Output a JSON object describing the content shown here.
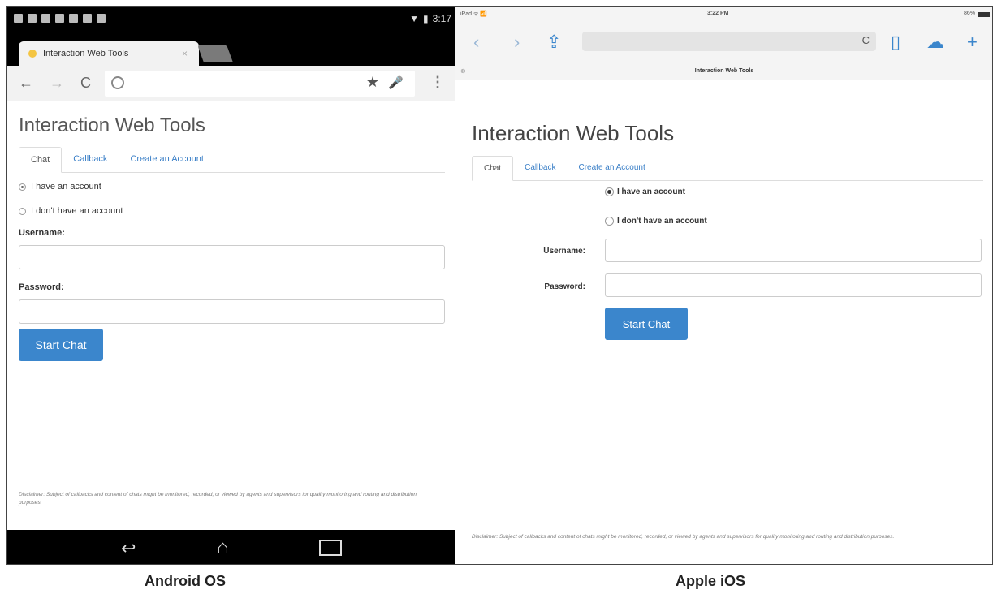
{
  "android": {
    "status_time": "3:17",
    "tab_title": "Interaction Web Tools",
    "tab_close": "×",
    "page_title": "Interaction Web Tools",
    "tabs": [
      "Chat",
      "Callback",
      "Create an Account"
    ],
    "radio_have": "I have an account",
    "radio_dont": "I don't have an account",
    "username_label": "Username:",
    "password_label": "Password:",
    "start_chat": "Start Chat",
    "disclaimer": "Disclaimer: Subject of callbacks and content of chats might be monitored, recorded, or viewed by agents and supervisors for quality monitoring and routing and distribution purposes.",
    "caption": "Android OS"
  },
  "ios": {
    "status_left": "iPad ᯤ 📶",
    "status_time": "3:22 PM",
    "status_battery": "86%",
    "tab_title": "Interaction Web Tools",
    "page_title": "Interaction Web Tools",
    "tabs": [
      "Chat",
      "Callback",
      "Create an Account"
    ],
    "radio_have": "I have an account",
    "radio_dont": "I don't have an account",
    "username_label": "Username:",
    "password_label": "Password:",
    "start_chat": "Start Chat",
    "disclaimer": "Disclaimer: Subject of callbacks and content of chats might be monitored, recorded, or viewed by agents and supervisors for quality monitoring and routing and distribution purposes.",
    "caption": "Apple iOS"
  },
  "icons": {
    "back": "back-arrow-icon",
    "forward": "forward-arrow-icon",
    "reload": "reload-icon",
    "bookmark": "star-icon",
    "mic": "mic-icon",
    "menu": "overflow-menu-icon",
    "share": "share-icon",
    "book": "bookmarks-icon",
    "cloud": "cloud-icon",
    "plus": "plus-icon"
  },
  "colors": {
    "accent": "#3b86cc",
    "link": "#3a7fc7"
  }
}
